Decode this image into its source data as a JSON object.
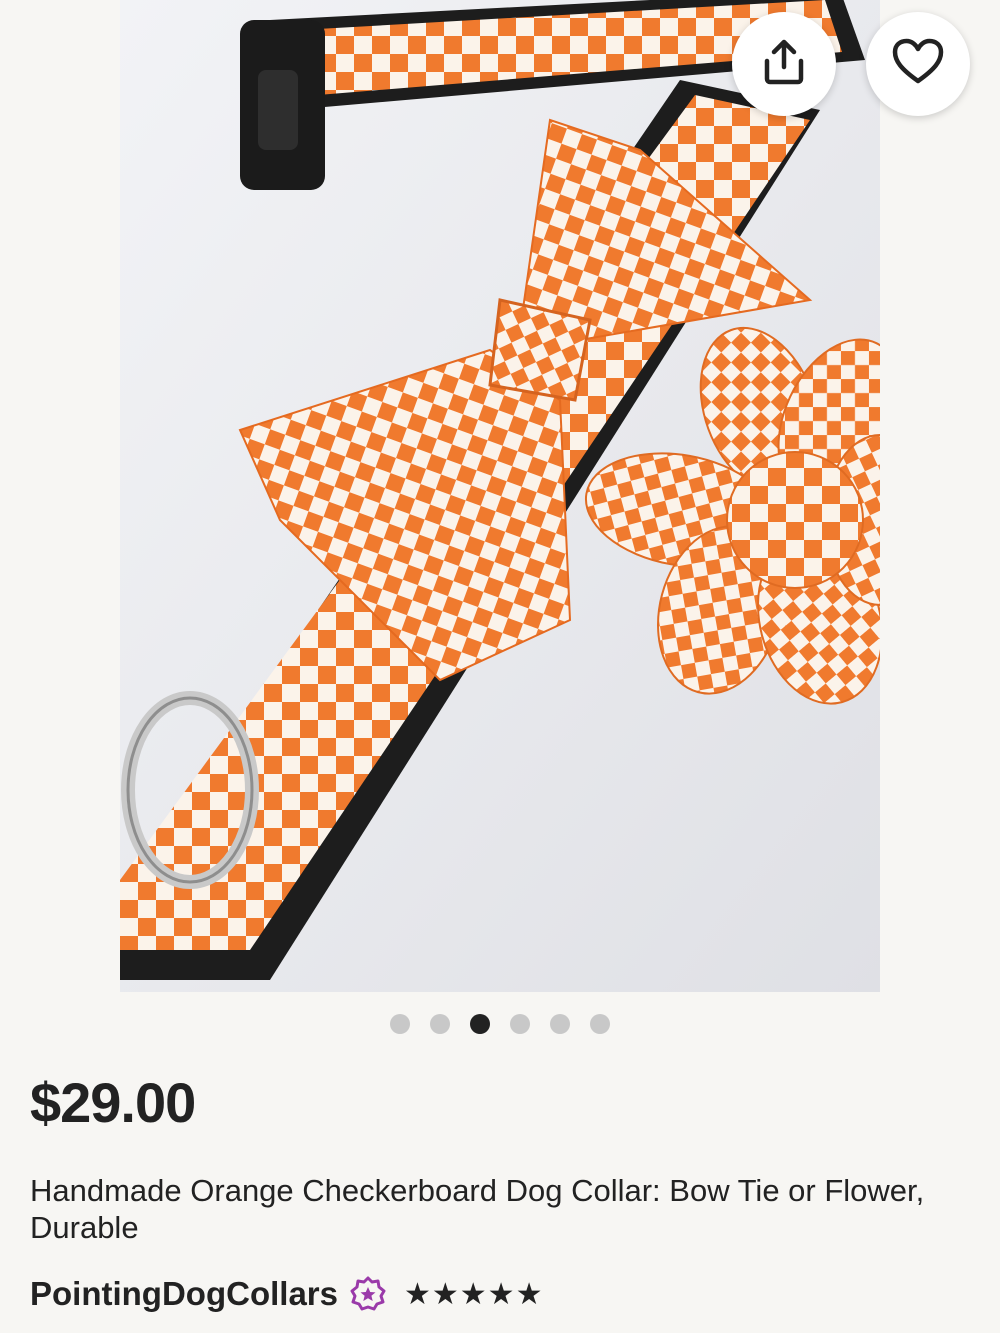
{
  "listing": {
    "price": "$29.00",
    "title": "Handmade Orange Checkerboard Dog Collar: Bow Tie or Flower, Durable"
  },
  "gallery": {
    "image_count": 6,
    "active_index": 2,
    "colors": {
      "accent_orange": "#f07a2e",
      "check_white": "#fbf3ea",
      "buckle_black": "#1d1d1d"
    }
  },
  "actions": {
    "share_icon": "share-icon",
    "favorite_icon": "heart-icon"
  },
  "shop": {
    "name": "PointingDogCollars",
    "badge_icon": "star-seller-icon",
    "badge_color": "#9a3aa9",
    "rating": 5,
    "stars": "★★★★★"
  }
}
